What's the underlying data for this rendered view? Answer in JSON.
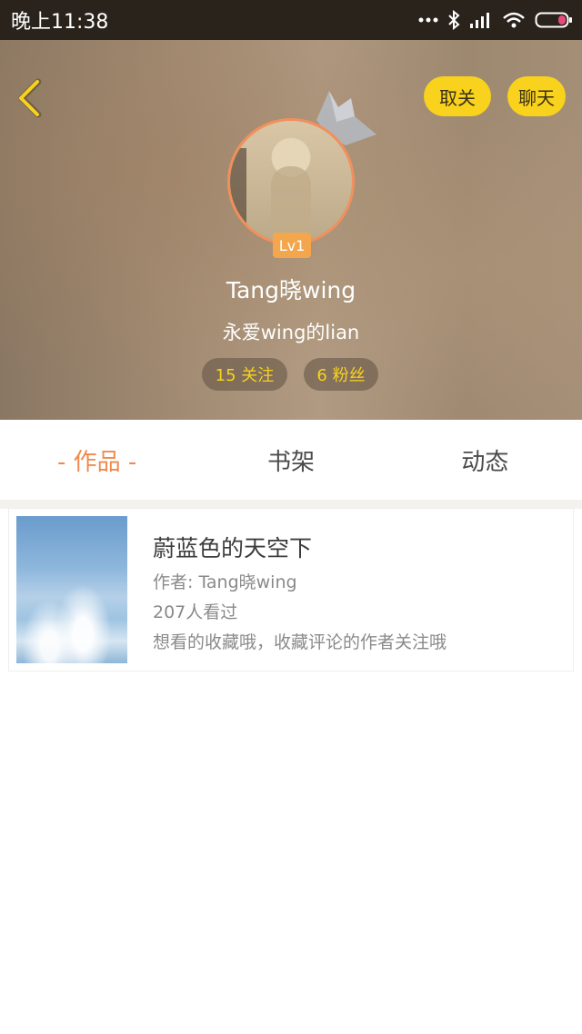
{
  "status_bar": {
    "time": "晚上11:38"
  },
  "header": {
    "unfollow_label": "取关",
    "chat_label": "聊天",
    "level": "Lv1",
    "username": "Tang晓wing",
    "signature": "永爱wing的lian",
    "following": "15 关注",
    "fans": "6 粉丝"
  },
  "tabs": [
    {
      "label": "- 作品 -",
      "active": true
    },
    {
      "label": "书架",
      "active": false
    },
    {
      "label": "动态",
      "active": false
    }
  ],
  "books": [
    {
      "title": "蔚蓝色的天空下",
      "author": "作者: Tang晓wing",
      "views": "207人看过",
      "description": "想看的收藏哦，收藏评论的作者关注哦"
    }
  ],
  "colors": {
    "accent_yellow": "#f8d21c",
    "accent_orange": "#ef8a4e",
    "level_badge": "#f3a64c"
  }
}
